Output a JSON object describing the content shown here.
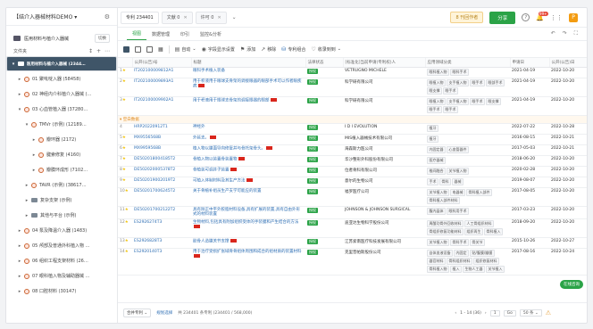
{
  "workspace": {
    "title": "【结介入器械材料DEMO ▾"
  },
  "database": {
    "name": "医用材料与植介入器械",
    "switch_label": "切换"
  },
  "folder_header": {
    "label": "文件夹"
  },
  "tree": [
    {
      "label": "医用材料与植介入器械 (2344…",
      "level": 0,
      "selected": true,
      "icon": "folder"
    },
    {
      "label": "01 聚吡啶入器 (58458)",
      "level": 1,
      "icon": "tag"
    },
    {
      "label": "02 神经内介科植介入器械 (…",
      "level": 1,
      "icon": "tag"
    },
    {
      "label": "03 心血管植入器 (37280…",
      "level": 1,
      "icon": "tag",
      "expanded": true
    },
    {
      "label": "TMVr (示例) (12189…",
      "level": 2,
      "icon": "tag",
      "expanded": true
    },
    {
      "label": "瓣环器 (2172)",
      "level": 3,
      "icon": "tag"
    },
    {
      "label": "腱索修复 (4160)",
      "level": 3,
      "icon": "tag"
    },
    {
      "label": "瓣膜环成形 (7102…",
      "level": 3,
      "icon": "tag"
    },
    {
      "label": "TAVR (示例) (38617…",
      "level": 2,
      "icon": "tag"
    },
    {
      "label": "复杂支架 (示例)",
      "level": 2,
      "icon": "folder"
    },
    {
      "label": "其他与平台 (示例)",
      "level": 2,
      "icon": "folder"
    },
    {
      "label": "04 泵及降温介入器 (1483)",
      "level": 1,
      "icon": "tag"
    },
    {
      "label": "05 颅部及普通外科植入物 …",
      "level": 1,
      "icon": "tag"
    },
    {
      "label": "06 组织工程支架材料 (26…",
      "level": 1,
      "icon": "tag"
    },
    {
      "label": "07 眼科植入物及辅助器械 …",
      "level": 1,
      "icon": "tag"
    },
    {
      "label": "08 口腔材料 (30147)",
      "level": 1,
      "icon": "tag"
    }
  ],
  "tabs": [
    {
      "label": "专利 234401",
      "active": true
    },
    {
      "label": "文献 0",
      "active": false
    },
    {
      "label": "许可 0",
      "active": false
    }
  ],
  "header_right": {
    "pill": "8 刊回作者",
    "share": "分享",
    "help": "?",
    "notify_count": "99+"
  },
  "view_tabs": [
    "视图",
    "数据管理",
    "印引",
    "监控&分析"
  ],
  "toolbar": {
    "auto": "自动",
    "fields": "字段显示设置",
    "add": "添加",
    "remove": "移除",
    "patent_group": "专利组合",
    "collect": "收录到到"
  },
  "columns": [
    "",
    "公开(公告)号",
    "标题",
    "法律状态",
    "[标准化]当前申请(专利权)人",
    "应用领域分类",
    "申请日",
    "公开(公告)日"
  ],
  "rows": [
    {
      "idx": "1",
      "star": true,
      "pn": "IT202100009812A1",
      "title": "眼科手术植入装备",
      "flag": false,
      "status": "授权",
      "assignee": "VETRUGNO MICHELE",
      "tags": [
        "眼科植入物",
        "眼科手术"
      ],
      "appdate": "2021-04-19",
      "pubdate": "2022-10-20"
    },
    {
      "idx": "2",
      "star": true,
      "pn": "IT202100009893A1",
      "title": "用于积液用于眼球支骨架的调接眼器的眼部手术可以作者眼疾病",
      "flag": true,
      "status": "授权",
      "assignee": "科学研有限公司",
      "tags": [
        "眼植入物",
        "支手植入物",
        "眼手术",
        "眼部手术",
        "眼支撑",
        "眼手术"
      ],
      "appdate": "2021-04-19",
      "pubdate": "2022-10-20"
    },
    {
      "idx": "3",
      "star": true,
      "pn": "IT202100009902A1",
      "title": "用于积液用于眼球支骨架的调接眼器的眼部",
      "flag": true,
      "status": "授权",
      "assignee": "科学研有限公司",
      "tags": [
        "眼植入物",
        "支手植入物",
        "眼手术",
        "眼支撑",
        "眼手术",
        "眼手术"
      ],
      "appdate": "2021-04-19",
      "pubdate": "2022-10-20"
    },
    {
      "group": "空白数据"
    },
    {
      "idx": "4",
      "star": false,
      "pn": "HRP20220912T1",
      "title": "神经外",
      "flag": false,
      "status": "授权",
      "assignee": "I D I EVOLUTION",
      "tags": [
        "植牙"
      ],
      "appdate": "2022-07-22",
      "pubdate": "2022-10-28"
    },
    {
      "idx": "5",
      "star": true,
      "pn": "MX9556568B",
      "title": "外延支。",
      "flag": true,
      "status": "授权",
      "assignee": "MIS植入器械技术有限公司",
      "tags": [
        "植牙"
      ],
      "appdate": "2016-08-15",
      "pubdate": "2022-10-21"
    },
    {
      "idx": "6",
      "star": true,
      "pn": "MX9959568B",
      "title": "植入物以膜面导向修复并与骨托架骨头。",
      "flag": true,
      "status": "授权",
      "assignee": "海森斯力医公司",
      "tags": [
        "内固定器",
        "心血管器件"
      ],
      "appdate": "2017-05-03",
      "pubdate": "2022-10-21"
    },
    {
      "idx": "7",
      "star": true,
      "pn": "DE502018004185T2",
      "title": "骨植入物以装置骨装置物",
      "flag": true,
      "status": "授权",
      "assignee": "华沙整形外科股份有限公司",
      "tags": [
        "医疗器械"
      ],
      "appdate": "2018-06-20",
      "pubdate": "2022-10-20"
    },
    {
      "idx": "8",
      "star": true,
      "pn": "DE502020005378T2",
      "title": "骨植装可调并子装置",
      "flag": true,
      "status": "授权",
      "assignee": "位者骨科有限公司",
      "tags": [
        "椎间融合",
        "关节植入物"
      ],
      "appdate": "2020-02-28",
      "pubdate": "2022-10-20"
    },
    {
      "idx": "9",
      "star": true,
      "pn": "DE502019002019T2",
      "title": "可植入体制材料及其生产方法",
      "flag": true,
      "status": "授权",
      "assignee": "意尔的生物公司",
      "tags": [
        "手术",
        "骨科",
        "器械"
      ],
      "appdate": "2019-08-07",
      "pubdate": "2022-10-20"
    },
    {
      "idx": "10",
      "star": true,
      "pn": "DE502017006245T2",
      "title": "关于骨植补组员生产支学可能应的装置",
      "flag": false,
      "status": "授权",
      "assignee": "福罗医疗公司",
      "tags": [
        "关节植入物",
        "电器械",
        "骨科植入部件",
        "骨科植入部件材料"
      ],
      "appdate": "2017-08-05",
      "pubdate": "2022-10-20"
    },
    {
      "idx": "11",
      "star": true,
      "pn": "DE502017002122T2",
      "title": "具有除正中平外胶脂材料设备,具有扩展的装置,具有自由外形式的材料装置",
      "flag": false,
      "status": "授权",
      "assignee": "JOHNSON & JOHNSON SURGICAL",
      "tags": [
        "腹内晶体",
        "眼科用手术"
      ],
      "appdate": "2017-03-23",
      "pubdate": "2022-10-20"
    },
    {
      "idx": "12",
      "star": true,
      "pn": "ES2926274T3",
      "title": "生物材料,包括具有附加组织受体的手装膜和产生结合的方法",
      "flag": true,
      "status": "授权",
      "assignee": "迪亚达生物科学股份公司",
      "tags": [
        "周酸功骨外回收材料",
        "人工骨组织材料",
        "骨组织修复功能材料",
        "组织再生",
        "骨科植入"
      ],
      "appdate": "2018-09-20",
      "pubdate": "2022-10-20"
    },
    {
      "idx": "13",
      "star": true,
      "pn": "ES2926828T3",
      "title": "胶骨人造膜关节支撑",
      "flag": true,
      "status": "授权",
      "assignee": "江苏索南医疗科技发展有限公司",
      "tags": [
        "关节植入物",
        "骨科手术",
        "骨关节"
      ],
      "appdate": "2015-10-26",
      "pubdate": "2022-10-27"
    },
    {
      "idx": "14",
      "star": true,
      "pn": "ES2920140T3",
      "title": "用于治疗受损扩张域骨骨组体周围和成合的组材质的装置材料",
      "flag": true,
      "status": "授权",
      "assignee": "克里普帕斯股份公司",
      "tags": [
        "自体血液设备",
        "内固定",
        "贴/腹膜/瓣膜",
        "器官材料",
        "骨科组织材料",
        "组织修复材料",
        "骨科植入物",
        "植入",
        "生物人工器",
        "关节植入"
      ],
      "appdate": "2017-08-16",
      "pubdate": "2022-10-24"
    }
  ],
  "footer": {
    "select": "合并专利",
    "link": "规划选择",
    "count_text": "共 234401 条专利 (234401 / 568,000)",
    "page_info": "1 - 14 (36)",
    "page": "1",
    "go": "Go",
    "per_page": "50 条"
  },
  "float_btn": "在线咨询"
}
